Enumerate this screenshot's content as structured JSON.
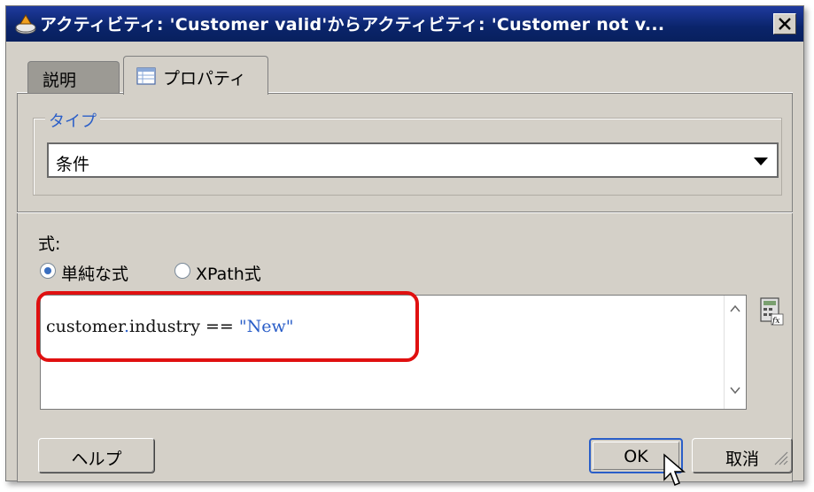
{
  "window": {
    "title": "アクティビティ: 'Customer valid'からアクティビティ: 'Customer not v..."
  },
  "tabs": [
    {
      "label": "説明"
    },
    {
      "label": "プロパティ"
    }
  ],
  "type_group": {
    "label": "タイプ",
    "selected_value": "条件"
  },
  "expression": {
    "label": "式:",
    "radio_options": [
      {
        "label": "単純な式",
        "checked": true
      },
      {
        "label": "XPath式",
        "checked": false
      }
    ],
    "code_parts": {
      "obj": "customer",
      "dot": ".",
      "field": "industry",
      "op": " == ",
      "value": "\"New\""
    }
  },
  "buttons": {
    "help": "ヘルプ",
    "ok": "OK",
    "cancel": "取消"
  },
  "colors": {
    "titlebar": "#0a246a",
    "highlight": "#e01010",
    "accent": "#2a5ec8"
  }
}
